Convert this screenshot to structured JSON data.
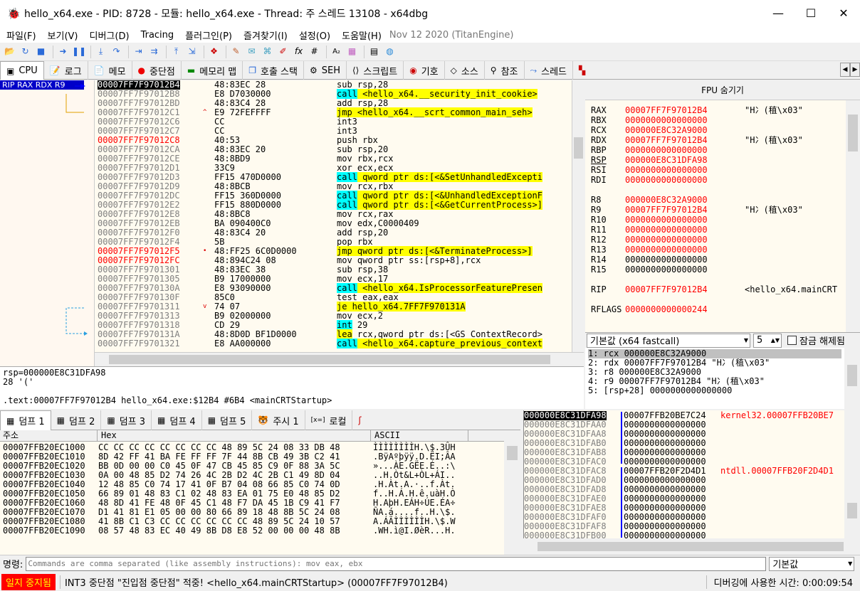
{
  "window": {
    "title": "hello_x64.exe - PID: 8728 - 모듈: hello_x64.exe - Thread: 주 스레드 13108 - x64dbg"
  },
  "menu": {
    "items": [
      "파일(F)",
      "보기(V)",
      "디버그(D)",
      "Tracing",
      "플러그인(P)",
      "즐겨찾기(I)",
      "설정(O)",
      "도움말(H)"
    ],
    "build": "Nov 12 2020 (TitanEngine)"
  },
  "tabs": [
    "CPU",
    "로그",
    "메모",
    "중단점",
    "메모리 맵",
    "호출 스택",
    "SEH",
    "스크립트",
    "기호",
    "소스",
    "참조",
    "스레드"
  ],
  "branch": {
    "regs_label": "RIP RAX RDX R9"
  },
  "disasm": [
    {
      "addr": "00007FF7F97012B4",
      "bytes": "48:83EC 28",
      "instr": "sub rsp,28",
      "style": "hl"
    },
    {
      "addr": "00007FF7F97012B8",
      "bytes": "E8 D7030000",
      "instr": "call <hello_x64.__security_init_cookie>",
      "kw": "call"
    },
    {
      "addr": "00007FF7F97012BD",
      "bytes": "48:83C4 28",
      "instr": "add rsp,28"
    },
    {
      "addr": "00007FF7F97012C1",
      "bytes": "E9 72FEFFFF",
      "instr": "jmp <hello_x64.__scrt_common_main_seh>",
      "kw": "jmp",
      "mark": "^"
    },
    {
      "addr": "00007FF7F97012C6",
      "bytes": "CC",
      "instr": "int3"
    },
    {
      "addr": "00007FF7F97012C7",
      "bytes": "CC",
      "instr": "int3"
    },
    {
      "addr": "00007FF7F97012C8",
      "bytes": "40:53",
      "instr": "push rbx",
      "style": "red"
    },
    {
      "addr": "00007FF7F97012CA",
      "bytes": "48:83EC 20",
      "instr": "sub rsp,20"
    },
    {
      "addr": "00007FF7F97012CE",
      "bytes": "48:8BD9",
      "instr": "mov rbx,rcx"
    },
    {
      "addr": "00007FF7F97012D1",
      "bytes": "33C9",
      "instr": "xor ecx,ecx"
    },
    {
      "addr": "00007FF7F97012D3",
      "bytes": "FF15 470D0000",
      "instr": "call qword ptr ds:[<&SetUnhandledExcepti",
      "kw": "call"
    },
    {
      "addr": "00007FF7F97012D9",
      "bytes": "48:8BCB",
      "instr": "mov rcx,rbx"
    },
    {
      "addr": "00007FF7F97012DC",
      "bytes": "FF15 360D0000",
      "instr": "call qword ptr ds:[<&UnhandledExceptionF",
      "kw": "call"
    },
    {
      "addr": "00007FF7F97012E2",
      "bytes": "FF15 880D0000",
      "instr": "call qword ptr ds:[<&GetCurrentProcess>]",
      "kw": "call"
    },
    {
      "addr": "00007FF7F97012E8",
      "bytes": "48:8BC8",
      "instr": "mov rcx,rax"
    },
    {
      "addr": "00007FF7F97012EB",
      "bytes": "BA 090400C0",
      "instr": "mov edx,C0000409"
    },
    {
      "addr": "00007FF7F97012F0",
      "bytes": "48:83C4 20",
      "instr": "add rsp,20"
    },
    {
      "addr": "00007FF7F97012F4",
      "bytes": "5B",
      "instr": "pop rbx"
    },
    {
      "addr": "00007FF7F97012F5",
      "bytes": "48:FF25 6C0D0000",
      "instr": "jmp qword ptr ds:[<&TerminateProcess>]",
      "kw": "jmp",
      "style": "red",
      "mark": "•"
    },
    {
      "addr": "00007FF7F97012FC",
      "bytes": "48:894C24 08",
      "instr": "mov qword ptr ss:[rsp+8],rcx",
      "style": "red"
    },
    {
      "addr": "00007FF7F9701301",
      "bytes": "48:83EC 38",
      "instr": "sub rsp,38"
    },
    {
      "addr": "00007FF7F9701305",
      "bytes": "B9 17000000",
      "instr": "mov ecx,17"
    },
    {
      "addr": "00007FF7F970130A",
      "bytes": "E8 93090000",
      "instr": "call <hello_x64.IsProcessorFeaturePresen",
      "kw": "call"
    },
    {
      "addr": "00007FF7F970130F",
      "bytes": "85C0",
      "instr": "test eax,eax"
    },
    {
      "addr": "00007FF7F9701311",
      "bytes": "74 07",
      "instr": "je hello_x64.7FF7F970131A",
      "kw": "je",
      "mark": "v"
    },
    {
      "addr": "00007FF7F9701313",
      "bytes": "B9 02000000",
      "instr": "mov ecx,2"
    },
    {
      "addr": "00007FF7F9701318",
      "bytes": "CD 29",
      "instr": "int 29",
      "kw": "int"
    },
    {
      "addr": "00007FF7F970131A",
      "bytes": "48:8D0D BF1D0000",
      "instr": "lea rcx,qword ptr ds:[<GS_ContextRecord>",
      "kw": "lea"
    },
    {
      "addr": "00007FF7F9701321",
      "bytes": "E8 AA000000",
      "instr": "call <hello_x64.capture_previous_context",
      "kw": "call"
    }
  ],
  "info": {
    "line1": "rsp=000000E8C31DFA98",
    "line2": "28 '('",
    "line3": ".text:00007FF7F97012B4 hello_x64.exe:$12B4 #6B4 <mainCRTStartup>"
  },
  "fpu_header": "FPU 숨기기",
  "registers": [
    {
      "name": "RAX",
      "value": "00007FF7F97012B4",
      "comment": "\"H冫(稙\\x03\"",
      "color": "red"
    },
    {
      "name": "RBX",
      "value": "0000000000000000",
      "comment": "",
      "color": "red"
    },
    {
      "name": "RCX",
      "value": "000000E8C32A9000",
      "comment": "",
      "color": "red"
    },
    {
      "name": "RDX",
      "value": "00007FF7F97012B4",
      "comment": "\"H冫(稙\\x03\"",
      "color": "red"
    },
    {
      "name": "RBP",
      "value": "0000000000000000",
      "comment": "",
      "color": "red"
    },
    {
      "name": "RSP",
      "value": "000000E8C31DFA98",
      "comment": "",
      "color": "red"
    },
    {
      "name": "RSI",
      "value": "0000000000000000",
      "comment": "",
      "color": "red"
    },
    {
      "name": "RDI",
      "value": "0000000000000000",
      "comment": "",
      "color": "red"
    },
    {
      "name": "",
      "value": "",
      "comment": "",
      "color": "red"
    },
    {
      "name": "R8",
      "value": "000000E8C32A9000",
      "comment": "",
      "color": "red"
    },
    {
      "name": "R9",
      "value": "00007FF7F97012B4",
      "comment": "\"H冫(稙\\x03\"",
      "color": "red"
    },
    {
      "name": "R10",
      "value": "0000000000000000",
      "comment": "",
      "color": "red"
    },
    {
      "name": "R11",
      "value": "0000000000000000",
      "comment": "",
      "color": "red"
    },
    {
      "name": "R12",
      "value": "0000000000000000",
      "comment": "",
      "color": "red"
    },
    {
      "name": "R13",
      "value": "0000000000000000",
      "comment": "",
      "color": "red"
    },
    {
      "name": "R14",
      "value": "0000000000000000",
      "comment": "",
      "color": "black"
    },
    {
      "name": "R15",
      "value": "0000000000000000",
      "comment": "",
      "color": "black"
    },
    {
      "name": "",
      "value": "",
      "comment": "",
      "color": "red"
    },
    {
      "name": "RIP",
      "value": "00007FF7F97012B4",
      "comment": "<hello_x64.mainCRT",
      "color": "red"
    },
    {
      "name": "",
      "value": "",
      "comment": "",
      "color": "red"
    },
    {
      "name": "RFLAGS",
      "value": "0000000000000244",
      "comment": "",
      "color": "red"
    }
  ],
  "callconv": {
    "selected": "기본값 (x64 fastcall)",
    "count": "5",
    "unlock_label": "잠금 해제됨"
  },
  "args": [
    "1: rcx 000000E8C32A9000",
    "2: rdx 00007FF7F97012B4 \"H冫(稙\\x03\"",
    "3: r8 000000E8C32A9000",
    "4: r9 00007FF7F97012B4 \"H冫(稙\\x03\"",
    "5: [rsp+28] 0000000000000000"
  ],
  "dump_tabs": [
    "덤프 1",
    "덤프 2",
    "덤프 3",
    "덤프 4",
    "덤프 5",
    "주시 1",
    "로컬"
  ],
  "dump_header": {
    "addr": "주소",
    "hex": "Hex",
    "ascii": "ASCII"
  },
  "dump": [
    {
      "addr": "00007FFB20EC1000",
      "hex": "CC CC CC CC CC CC CC CC 48 89 5C 24 08 33 DB 48",
      "ascii": "ÌÌÌÌÌÌÌÌH.\\$.3ÛH"
    },
    {
      "addr": "00007FFB20EC1010",
      "hex": "8D 42 FF 41 BA FE FF FF 7F 44 8B CB 49 3B C2 41",
      "ascii": ".BÿAºþÿÿ.D.ËI;ÂA"
    },
    {
      "addr": "00007FFB20EC1020",
      "hex": "BB 0D 00 00 C0 45 0F 47 CB 45 85 C9 0F 88 3A 5C",
      "ascii": "»...ÀE.GËE.É..:\\"
    },
    {
      "addr": "00007FFB20EC1030",
      "hex": "0A 00 48 85 D2 74 26 4C 2B D2 4C 2B C1 49 8D 04",
      "ascii": "..H.Òt&L+ÒL+ÁI.."
    },
    {
      "addr": "00007FFB20EC1040",
      "hex": "12 48 85 C0 74 17 41 0F B7 04 08 66 85 C0 74 0D",
      "ascii": ".H.Àt.A.·..f.Àt."
    },
    {
      "addr": "00007FFB20EC1050",
      "hex": "66 89 01 48 83 C1 02 48 83 EA 01 75 E0 48 85 D2",
      "ascii": "f..H.Á.H.ê.uàH.Ò"
    },
    {
      "addr": "00007FFB20EC1060",
      "hex": "48 8D 41 FE 48 0F 45 C1 48 F7 DA 45 1B C9 41 F7",
      "ascii": "H.AþH.EÁH÷ÚE.ÉA÷"
    },
    {
      "addr": "00007FFB20EC1070",
      "hex": "D1 41 81 E1 05 00 00 80 66 89 18 48 8B 5C 24 08",
      "ascii": "ÑA.á....f..H.\\$."
    },
    {
      "addr": "00007FFB20EC1080",
      "hex": "41 8B C1 C3 CC CC CC CC CC CC 48 89 5C 24 10 57",
      "ascii": "A.ÁÃÌÌÌÌÌÌH.\\$.W"
    },
    {
      "addr": "00007FFB20EC1090",
      "hex": "08 57 48 83 EC 40 49 8B D8 E8 52 00 00 00 48 8B",
      "ascii": ".WH.ì@I.ØèR...H."
    }
  ],
  "stack": [
    {
      "addr": "000000E8C31DFA98",
      "value": "00007FFB20BE7C24",
      "comment": "kernel32.00007FFB20BE7"
    },
    {
      "addr": "000000E8C31DFAA0",
      "value": "0000000000000000",
      "comment": ""
    },
    {
      "addr": "000000E8C31DFAA8",
      "value": "0000000000000000",
      "comment": ""
    },
    {
      "addr": "000000E8C31DFAB0",
      "value": "0000000000000000",
      "comment": ""
    },
    {
      "addr": "000000E8C31DFAB8",
      "value": "0000000000000000",
      "comment": ""
    },
    {
      "addr": "000000E8C31DFAC0",
      "value": "0000000000000000",
      "comment": ""
    },
    {
      "addr": "000000E8C31DFAC8",
      "value": "00007FFB20F2D4D1",
      "comment": "ntdll.00007FFB20F2D4D1"
    },
    {
      "addr": "000000E8C31DFAD0",
      "value": "0000000000000000",
      "comment": ""
    },
    {
      "addr": "000000E8C31DFAD8",
      "value": "0000000000000000",
      "comment": ""
    },
    {
      "addr": "000000E8C31DFAE0",
      "value": "0000000000000000",
      "comment": ""
    },
    {
      "addr": "000000E8C31DFAE8",
      "value": "0000000000000000",
      "comment": ""
    },
    {
      "addr": "000000E8C31DFAF0",
      "value": "0000000000000000",
      "comment": ""
    },
    {
      "addr": "000000E8C31DFAF8",
      "value": "0000000000000000",
      "comment": ""
    },
    {
      "addr": "000000E8C31DFB00",
      "value": "0000000000000000",
      "comment": ""
    }
  ],
  "command": {
    "label": "명령:",
    "placeholder": "Commands are comma separated (like assembly instructions): mov eax, ebx",
    "mode": "기본값"
  },
  "status": {
    "state": "일지 중지됨",
    "message": "INT3 중단점 \"진입점 중단점\" 적중! <hello_x64.mainCRTStartup> (00007FF7F97012B4)",
    "time": "디버깅에 사용한 시간: 0:00:09:54"
  }
}
